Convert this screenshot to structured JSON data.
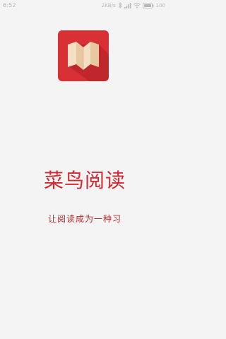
{
  "status_bar": {
    "time": "6:52",
    "speed": "2KB/s",
    "battery_text": "100"
  },
  "app": {
    "title": "菜鸟阅读",
    "slogan": "让阅读成为一种习",
    "brand_color": "#d4262e"
  },
  "icons": {
    "logo": "book-logo-icon",
    "signal": "signal-icon",
    "wifi": "wifi-icon",
    "bluetooth": "bluetooth-icon",
    "battery": "battery-icon"
  }
}
